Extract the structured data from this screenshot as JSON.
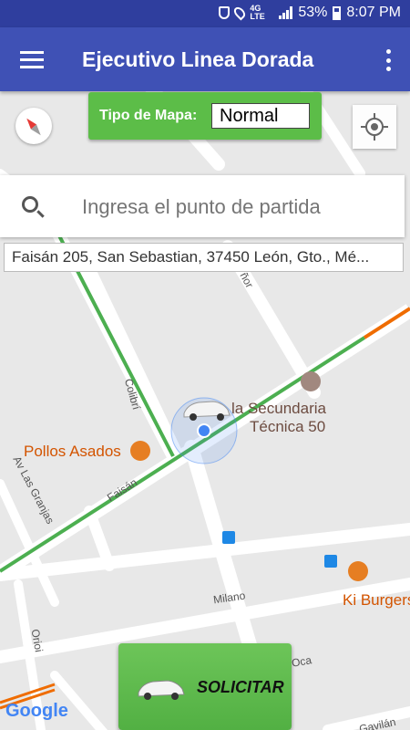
{
  "status_bar": {
    "network": "4G LTE",
    "battery": "53%",
    "time": "8:07 PM"
  },
  "app_bar": {
    "title": "Ejecutivo Linea Dorada"
  },
  "map_type": {
    "label": "Tipo de Mapa:",
    "selected": "Normal"
  },
  "search": {
    "placeholder": "Ingresa el punto de partida"
  },
  "address": {
    "text": "Faisán 205, San Sebastian, 37450 León, Gto., Mé..."
  },
  "map": {
    "places": [
      {
        "name": "la Secundaria",
        "line2": "Técnica 50"
      },
      {
        "name": "Pollos Asados"
      },
      {
        "name": "Ki Burgers"
      }
    ],
    "streets": [
      "Colibrí",
      "Faisán",
      "Av Las Granjas",
      "Milano",
      "Oca",
      "Orioi",
      "Gavilán",
      "ñor"
    ]
  },
  "action": {
    "label": "SOLICITAR"
  },
  "branding": {
    "google": "Google"
  },
  "colors": {
    "status_bar": "#2f3e9e",
    "app_bar": "#3f51b5",
    "accent_green": "#5cbd48",
    "traffic_green": "#4caf50",
    "traffic_orange": "#ef6c00",
    "poi_orange": "#e67e22",
    "location_blue": "#4285f4"
  }
}
